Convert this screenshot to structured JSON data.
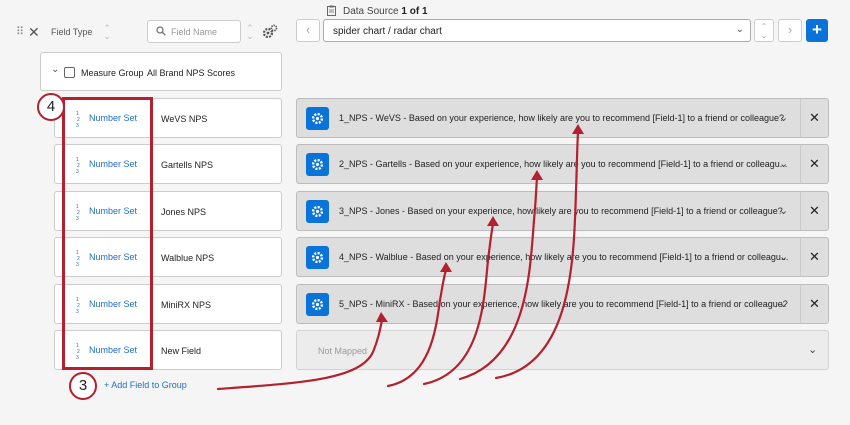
{
  "header": {
    "field_type_label": "Field Type",
    "search_placeholder": "Field Name",
    "data_source_prefix": "Data Source",
    "data_source_current": "1",
    "data_source_of": "of",
    "data_source_total": "1",
    "source_value": "spider chart / radar chart",
    "add_label": "+"
  },
  "group": {
    "label": "Measure Group",
    "name": "All Brand NPS Scores"
  },
  "fields": [
    {
      "type": "Number Set",
      "name": "WeVS NPS",
      "mapping": "1_NPS - WeVS - Based on your experience, how likely are you to recommend [Field-1] to a friend or colleague?"
    },
    {
      "type": "Number Set",
      "name": "Gartells NPS",
      "mapping": "2_NPS - Gartells - Based on your experience, how likely are you to recommend [Field-1] to a friend or colleagu..."
    },
    {
      "type": "Number Set",
      "name": "Jones NPS",
      "mapping": "3_NPS - Jones - Based on your experience, how likely are you to recommend [Field-1] to a friend or colleague?"
    },
    {
      "type": "Number Set",
      "name": "Walblue NPS",
      "mapping": "4_NPS - Walblue - Based on your experience, how likely are you to recommend [Field-1] to a friend or colleagu..."
    },
    {
      "type": "Number Set",
      "name": "MiniRX NPS",
      "mapping": "5_NPS - MiniRX - Based on your experience, how likely are you to recommend [Field-1] to a friend or colleague?"
    },
    {
      "type": "Number Set",
      "name": "New Field",
      "mapping": "Not Mapped"
    }
  ],
  "add_field_link": "+ Add Field to Group",
  "annotations": {
    "callout_4": "4",
    "callout_3": "3"
  },
  "colors": {
    "accent": "#0a73d9",
    "annotation": "#b3202e",
    "link": "#1f6fc5"
  }
}
